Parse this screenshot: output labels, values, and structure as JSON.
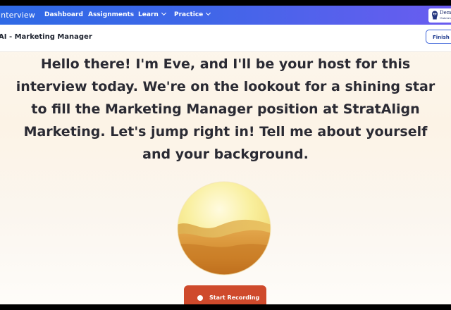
{
  "nav": {
    "brand": "interview",
    "items": [
      {
        "label": "Dashboard",
        "has_menu": false
      },
      {
        "label": "Assignments",
        "has_menu": false
      },
      {
        "label": "Learn",
        "has_menu": true
      },
      {
        "label": "Practice",
        "has_menu": true
      }
    ],
    "logo": {
      "name": "Demo",
      "sub": "Univers"
    }
  },
  "header": {
    "title": "AI - Marketing Manager",
    "finish_label": "Finish Interview"
  },
  "main": {
    "host_message": "Hello there! I'm Eve, and I'll be your host for this interview today. We're on the lookout for a shining star to fill the Marketing Manager position at StratAlign Marketing. Let's jump right in! Tell me about yourself and your background.",
    "record_label": "Start Recording"
  },
  "colors": {
    "nav_gradient_start": "#2f6ae6",
    "nav_gradient_end": "#6a5cf0",
    "record_button": "#cf4a2c",
    "orb_top": "#f6e87a",
    "orb_bottom": "#c2701c"
  },
  "icons": {
    "logo": "owl-logo-icon",
    "record": "record-dot-icon",
    "menu": "chevron-down-icon"
  }
}
